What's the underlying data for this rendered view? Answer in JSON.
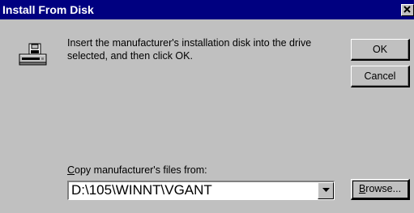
{
  "window": {
    "title": "Install From Disk",
    "close_icon": "close-icon"
  },
  "message": {
    "line1": "Insert the manufacturer's installation disk into the drive",
    "line2": "selected, and then click OK."
  },
  "buttons": {
    "ok": "OK",
    "cancel": "Cancel",
    "browse_mnemonic": "B",
    "browse_rest": "rowse..."
  },
  "copy_from": {
    "label_mnemonic": "C",
    "label_rest": "opy manufacturer's files from:",
    "value": "D:\\105\\WINNT\\VGANT"
  },
  "icons": {
    "disk": "disk-drive-icon",
    "dropdown": "chevron-down-icon"
  },
  "colors": {
    "title_bar": "#000080",
    "face": "#c0c0c0"
  }
}
